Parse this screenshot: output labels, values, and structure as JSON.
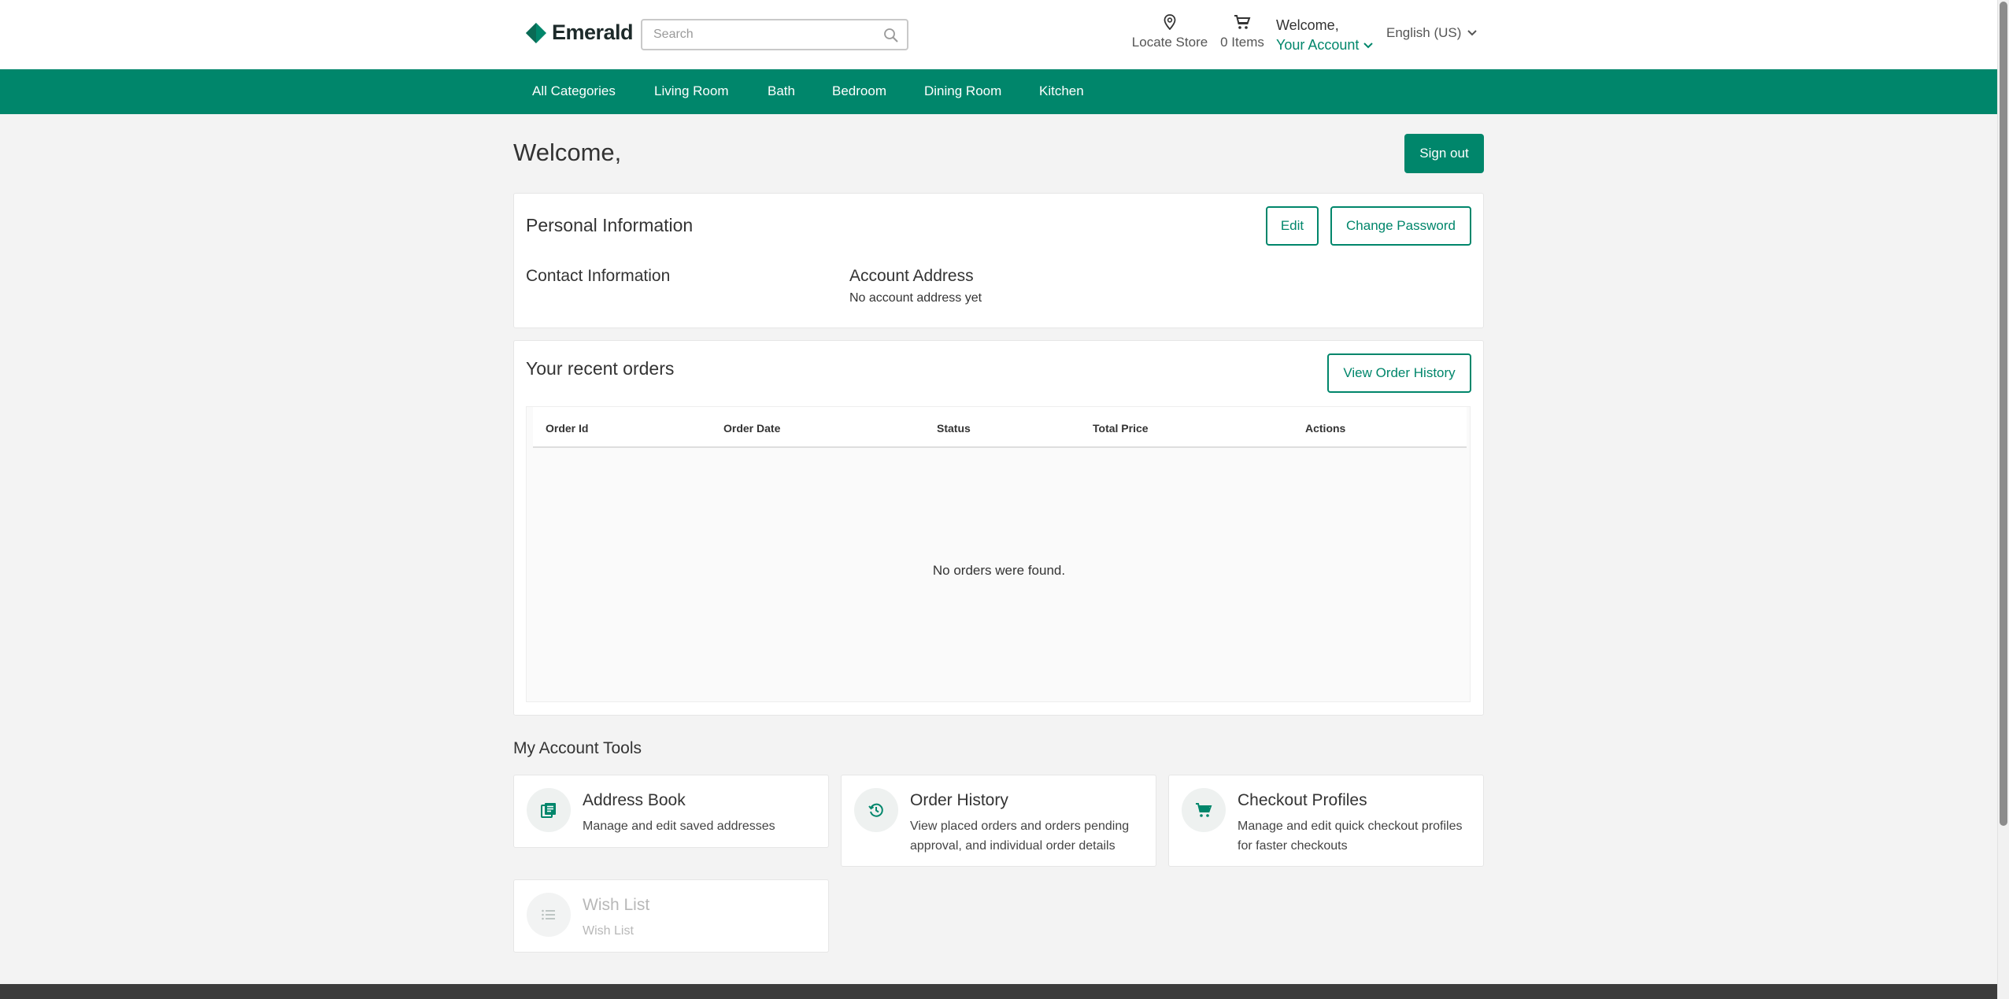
{
  "header": {
    "brand": "Emerald",
    "search_placeholder": "Search",
    "locate_label": "Locate Store",
    "cart_label": "0 Items",
    "welcome": "Welcome,",
    "account_label": "Your Account",
    "language": "English (US)"
  },
  "nav": {
    "items": [
      "All Categories",
      "Living Room",
      "Bath",
      "Bedroom",
      "Dining Room",
      "Kitchen"
    ]
  },
  "main": {
    "title": "Welcome,",
    "sign_out": "Sign out",
    "personal": {
      "heading": "Personal Information",
      "edit": "Edit",
      "change_password": "Change Password",
      "contact_heading": "Contact Information",
      "address_heading": "Account Address",
      "address_value": "No account address yet"
    },
    "orders": {
      "heading": "Your recent orders",
      "view_history": "View Order History",
      "columns": [
        "Order Id",
        "Order Date",
        "Status",
        "Total Price",
        "Actions"
      ],
      "empty": "No orders were found."
    },
    "tools": {
      "heading": "My Account Tools",
      "items": [
        {
          "title": "Address Book",
          "desc": "Manage and edit saved addresses",
          "icon": "address-book-icon"
        },
        {
          "title": "Order History",
          "desc": "View placed orders and orders pending approval, and individual order details",
          "icon": "history-icon"
        },
        {
          "title": "Checkout Profiles",
          "desc": "Manage and edit quick checkout profiles for faster checkouts",
          "icon": "cart-icon"
        },
        {
          "title": "Wish List",
          "desc": "Wish List",
          "icon": "list-icon"
        }
      ]
    }
  },
  "colors": {
    "brand": "#00866b",
    "header_bg": "#ffffff",
    "page_bg": "#f3f3f3",
    "footer": "#3b3b3b"
  }
}
